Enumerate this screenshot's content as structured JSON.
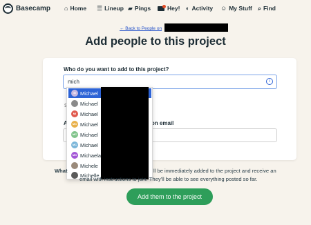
{
  "nav": {
    "brand": "Basecamp",
    "items": [
      {
        "label": "Home",
        "icon": "home-icon"
      },
      {
        "label": "Lineup",
        "icon": "lineup-icon"
      },
      {
        "label": "Pings",
        "icon": "pings-icon"
      },
      {
        "label": "Hey!",
        "icon": "hey-icon"
      },
      {
        "label": "Activity",
        "icon": "activity-icon"
      },
      {
        "label": "My Stuff",
        "icon": "my-stuff-icon"
      },
      {
        "label": "Find",
        "icon": "find-icon"
      }
    ]
  },
  "breadcrumb": "← Back to People on",
  "title": "Add people to this project",
  "form": {
    "who_label": "Who do you want to add to this project?",
    "search_value": "mich",
    "second_label_left": "A",
    "second_label_right": "tion email",
    "hint_char": "S"
  },
  "dropdown": {
    "items": [
      {
        "label": "Michael",
        "avatar": "M",
        "color": "#c7b8e0",
        "selected": true
      },
      {
        "label": "Michael",
        "avatar": "",
        "color": "#8a8a8a",
        "selected": false
      },
      {
        "label": "Michael",
        "avatar": "MI",
        "color": "#e05a4e",
        "selected": false
      },
      {
        "label": "Michael",
        "avatar": "MC",
        "color": "#e8b04a",
        "selected": false
      },
      {
        "label": "Michael",
        "avatar": "MC",
        "color": "#7fc38a",
        "selected": false
      },
      {
        "label": "Michael",
        "avatar": "MC",
        "color": "#7bb6d9",
        "selected": false
      },
      {
        "label": "Michaela",
        "avatar": "MD",
        "color": "#a357d6",
        "selected": false
      },
      {
        "label": "Michele",
        "avatar": "",
        "color": "#9a8a7a",
        "selected": false
      },
      {
        "label": "Michelle",
        "avatar": "",
        "color": "#5a5a5a",
        "selected": false
      }
    ]
  },
  "note": {
    "lead": "What",
    "line1": "ll be immediately added to the project and receive an",
    "line2": "email with instructions to join. They’ll be able to see everything posted so far."
  },
  "cta": "Add them to the project",
  "colors": {
    "background": "#f7f3ec",
    "accent_blue": "#2d63d6",
    "button_green": "#2e9e5a"
  }
}
